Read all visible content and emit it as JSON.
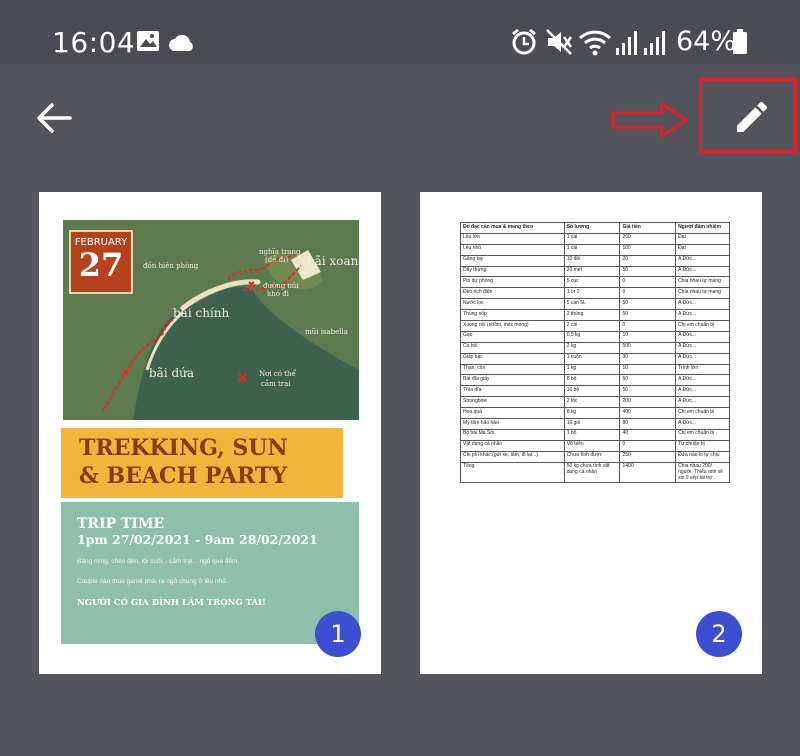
{
  "status_bar": {
    "time": "16:04",
    "battery": "64%"
  },
  "toolbar": {
    "back_icon": "arrow-left-icon",
    "edit_icon": "pencil-icon"
  },
  "pages": [
    {
      "number": "1",
      "poster": {
        "month": "FEBRUARY",
        "day": "27",
        "map_labels": {
          "den_bien_phong": "đồn biên phòng",
          "nghia_trang": "nghĩa trang",
          "de_di": "(dễ đi)",
          "bai_xoan": "bãi xoan",
          "duong_nui": "đường núi",
          "kho_di": "khó đi",
          "bai_chinh": "bãi chính",
          "mui_isabella": "mũi isabella",
          "bai_dua": "bãi dứa",
          "noi_co_the": "Nơi có thể",
          "cam_trai": "cắm trại"
        },
        "title_line1": "TREKKING, SUN",
        "title_line2": "& BEACH PARTY",
        "trip_title": "TRIP TIME",
        "trip_time": "1pm 27/02/2021 - 9am 28/02/2021",
        "line1": "Băng rừng, chèo đèo, lội suối... cắm trại... ngủ qua đêm.",
        "line2": "Couple nào thua game phải ra ngủ chung ở lều nhỏ.",
        "slogan": "NGƯỜI CÓ GIA ĐÌNH LÀM TRỌNG TÀI!"
      }
    },
    {
      "number": "2",
      "table": {
        "headers": [
          "Đồ đạc cần mua & mang theo",
          "Số lượng",
          "Giá tiền",
          "Người đảm nhiệm"
        ],
        "rows": [
          [
            "Lều lớn",
            "1 cái",
            "260",
            "Đạt"
          ],
          [
            "Lều nhỏ",
            "1 cái",
            "100",
            "Đạt"
          ],
          [
            "Găng tay",
            "10 đôi",
            "20",
            "A Đức..."
          ],
          [
            "Dây thừng",
            "20 mét",
            "50",
            "A Đức..."
          ],
          [
            "Pin dự phòng",
            "5 cục",
            "0",
            "Chia nhau tự mang"
          ],
          [
            "Đèn tích điện",
            "1 or 2",
            "0",
            "Chia nhau tự mang"
          ],
          [
            "Nước lọc",
            "5 can 5L",
            "50",
            "A Đức..."
          ],
          [
            "Thùng xốp",
            "2 thùng",
            "50",
            "A Đức..."
          ],
          [
            "Xoong nồi (nhôm, inox mỏng)",
            "2 cái",
            "0",
            "Chị em chuẩn bị"
          ],
          [
            "Gạo",
            "0,5 kg",
            "10",
            "A Đức..."
          ],
          [
            "Cá hồi",
            "2 kg",
            "500",
            "A Đức..."
          ],
          [
            "Giấy bạc",
            "1 cuộn",
            "30",
            "A Đức..."
          ],
          [
            "Than, cồn",
            "1 kg",
            "10",
            "Trình lớn"
          ],
          [
            "Bát đĩa giấy",
            "8 bộ",
            "50",
            "A Đức..."
          ],
          [
            "Thìa dĩa",
            "10 bộ",
            "50",
            "A Đức..."
          ],
          [
            "Strongbow",
            "2 lốc",
            "200",
            "A Đức..."
          ],
          [
            "Hoa quả",
            "8 kg",
            "400",
            "Chị em chuẩn bị"
          ],
          [
            "Mỳ tôm hảo hảo",
            "16 gói",
            "80",
            "A Đức..."
          ],
          [
            "Bộ bài Ma Sói",
            "1 bộ",
            "40",
            "Chị em chuẩn bị"
          ],
          [
            "Vật dụng cá nhân",
            "Vô biên",
            "0",
            "Tự chuẩn bị"
          ],
          [
            "Chi phí khác (gửi xe, tắm, đi lại...)",
            "Chưa tính được",
            "250",
            "Đứa nào lo tự chịu"
          ],
          [
            "Tổng",
            "50 kg chưa tính vật dụng cá nhân",
            "1400",
            "Chia nhau 200/ người. Thiếu anh sẽ xin 2 sếp tài trợ."
          ]
        ]
      }
    }
  ]
}
